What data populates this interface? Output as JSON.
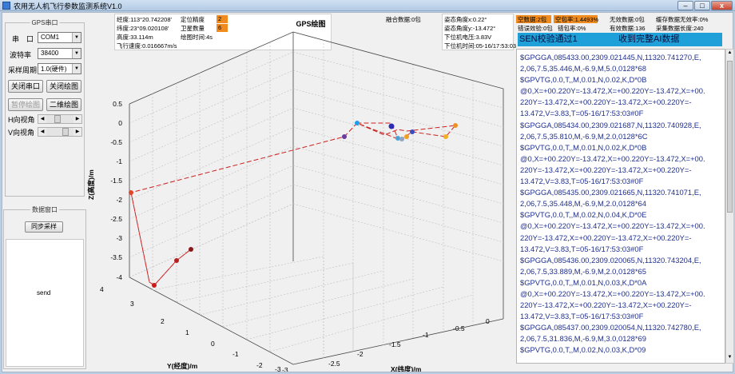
{
  "window": {
    "title": "农用无人机飞行参数监测系统V1.0",
    "min_label": "–",
    "max_label": "□",
    "close_label": "x"
  },
  "serial": {
    "group_title": "GPS串口",
    "port_label": "串　口",
    "port_value": "COM1",
    "baud_label": "波特率",
    "baud_value": "38400",
    "period_label": "采样周期",
    "period_value": "1.0(硬件)",
    "close_port_btn": "关闭串口",
    "close_plot_btn": "关闭绘图",
    "pause_plot_btn": "暂停绘图",
    "plot2d_btn": "二维绘图",
    "h_view_label": "H向视角",
    "v_view_label": "V向视角"
  },
  "data_port": {
    "group_title": "数据窗口",
    "sync_btn": "同步采样",
    "send_text": "send"
  },
  "status": {
    "longitude": "经度:113°20.742208'",
    "latitude": "纬度:23°09.020108'",
    "altitude": "高度:33.114m",
    "speed": "飞行速度:0.016667m/s",
    "precision_label": "定位精度",
    "precision_value": "2",
    "sats_label": "卫星数量",
    "sats_value": "6",
    "elapsed": "绘图时间:4s",
    "fused_data": "融合数据:0包",
    "attitude_x": "姿态角度x:0.22°",
    "attitude_y": "姿态角度y:-13.472°",
    "voltage": "下位机电压:3.83V",
    "time": "下位机时间:05-16/17:53:03",
    "null_packets": "空数据:2包",
    "null_rate": "空包率:1.4493%",
    "invalid_packets": "无效数据:0包",
    "cache_invalid": "缓存数据无效率:0%",
    "check_error": "错误效验:0包",
    "error_rate": "错包率:0%",
    "valid_count": "有效数据:136",
    "cache_len": "采集数据长度:240"
  },
  "banner": {
    "left": "SEN校验通过1",
    "right": "收到完整AI数据"
  },
  "plot": {
    "title": "GPS绘图",
    "z_label": "Z(高度)/m",
    "y_label": "Y(经度)/m",
    "x_label": "X(纬度)/m",
    "z_ticks": [
      "0.5",
      "0",
      "-0.5",
      "-1",
      "-1.5",
      "-2",
      "-2.5",
      "-3",
      "-3.5",
      "-4"
    ],
    "y_ticks": [
      "4",
      "3",
      "2",
      "1",
      "0",
      "-1",
      "-2",
      "-3"
    ],
    "x_ticks": [
      "-3",
      "-2.5",
      "-2",
      "-1.5",
      "-1",
      "-0.5",
      "0"
    ]
  },
  "console_lines": [
    "$GPGGA,085433.00,2309.021445,N,11320.741270,E,",
    "2,06,7.5,35.446,M,-6.9,M,5.0,0128*68",
    "$GPVTG,0.0,T,,M,0.01,N,0.02,K,D*0B",
    "@0,X=+00.220Y=-13.472,X=+00.220Y=-13.472,X=+00.",
    "220Y=-13.472,X=+00.220Y=-13.472,X=+00.220Y=-",
    "13.472,V=3.83,T=05-16/17:53:03#0F",
    "$GPGGA,085434.00,2309.021687,N,11320.740928,E,",
    "2,06,7.5,35.810,M,-6.9,M,2.0,0128*6C",
    "$GPVTG,0.0,T,,M,0.01,N,0.02,K,D*0B",
    "@0,X=+00.220Y=-13.472,X=+00.220Y=-13.472,X=+00.",
    "220Y=-13.472,X=+00.220Y=-13.472,X=+00.220Y=-",
    "13.472,V=3.83,T=05-16/17:53:03#0F",
    "$GPGGA,085435.00,2309.021665,N,11320.741071,E,",
    "2,06,7.5,35.448,M,-6.9,M,2.0,0128*64",
    "$GPVTG,0.0,T,,M,0.02,N,0.04,K,D*0E",
    "@0,X=+00.220Y=-13.472,X=+00.220Y=-13.472,X=+00.",
    "220Y=-13.472,X=+00.220Y=-13.472,X=+00.220Y=-",
    "13.472,V=3.83,T=05-16/17:53:03#0F",
    "$GPGGA,085436.00,2309.020065,N,11320.743204,E,",
    "2,06,7.5,33.889,M,-6.9,M,2.0,0128*65",
    "$GPVTG,0.0,T,,M,0.01,N,0.03,K,D*0A",
    "@0,X=+00.220Y=-13.472,X=+00.220Y=-13.472,X=+00.",
    "220Y=-13.472,X=+00.220Y=-13.472,X=+00.220Y=-",
    "13.472,V=3.83,T=05-16/17:53:03#0F",
    "$GPGGA,085437.00,2309.020054,N,11320.742780,E,",
    "2,06,7.5,31.836,M,-6.9,M,3.0,0128*69",
    "$GPVTG,0.0,T,,M,0.02,N,0.03,K,D*09"
  ],
  "colors": {
    "banner_bg": "#1fa0d8",
    "orange": "#f08c1e",
    "console_text": "#1f2f8f",
    "path_line": "#cc2020"
  },
  "chart_data": {
    "type": "scatter",
    "title": "GPS绘图",
    "xlabel": "X(纬度)/m",
    "ylabel": "Y(经度)/m",
    "zlabel": "Z(高度)/m",
    "xlim": [
      -3,
      0
    ],
    "ylim": [
      -3,
      4
    ],
    "zlim": [
      -4,
      0.5
    ],
    "grid": true
  }
}
